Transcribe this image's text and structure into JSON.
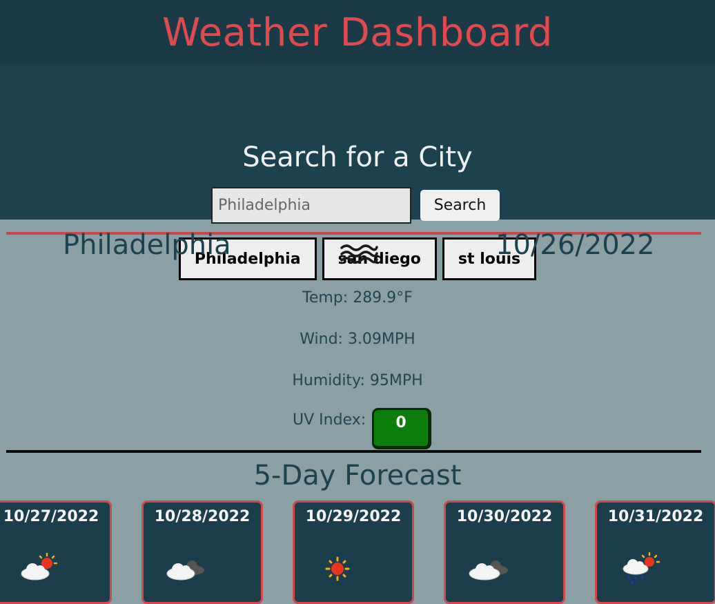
{
  "app": {
    "title": "Weather Dashboard"
  },
  "search": {
    "heading": "Search for a City",
    "input_value": "Philadelphia",
    "button_label": "Search"
  },
  "history": [
    "Philadelphia",
    "san diego",
    "st louis"
  ],
  "current": {
    "city": "Philadelphia",
    "date": "10/26/2022",
    "icon": "mist-icon",
    "temp": "Temp: 289.9°F",
    "wind": "Wind: 3.09MPH",
    "humidity": "Humidity: 95MPH",
    "uv_label": "UV Index:",
    "uv_value": "0",
    "uv_color": "#0b7d0b"
  },
  "forecast": {
    "heading": "5-Day Forecast",
    "days": [
      {
        "date": "10/27/2022",
        "icon": "partly-cloudy-icon"
      },
      {
        "date": "10/28/2022",
        "icon": "cloudy-icon"
      },
      {
        "date": "10/29/2022",
        "icon": "sunny-icon"
      },
      {
        "date": "10/30/2022",
        "icon": "cloudy-icon"
      },
      {
        "date": "10/31/2022",
        "icon": "rain-sun-icon"
      }
    ]
  },
  "colors": {
    "header_bg": "#1a3a48",
    "title_red": "#e04a4f",
    "panel_bg": "#1c4250",
    "content_bg": "#8aa0a5",
    "card_border": "#d2494b"
  }
}
